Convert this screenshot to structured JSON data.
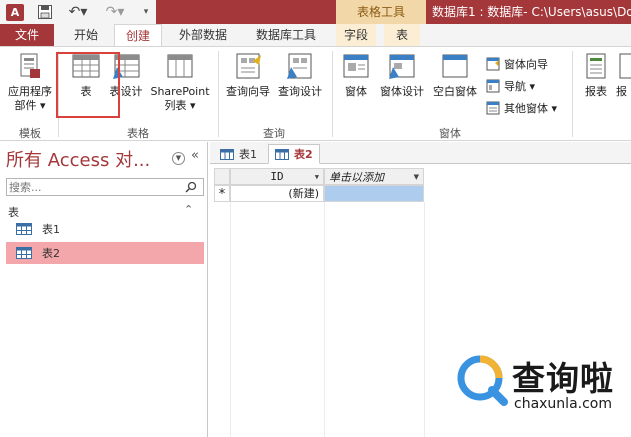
{
  "window": {
    "title": "数据库1 : 数据库- C:\\Users\\asus\\Do",
    "context_tab": "表格工具"
  },
  "quick_access": {
    "app_icon": "A",
    "icons": [
      "access-app-icon",
      "save-icon",
      "undo-icon",
      "redo-icon",
      "customize-quick-access-icon"
    ]
  },
  "ribbon_tabs": {
    "file": "文件",
    "home": "开始",
    "create": "创建",
    "external": "外部数据",
    "dbtools": "数据库工具",
    "fields": "字段",
    "table": "表"
  },
  "ribbon": {
    "templates": {
      "app_parts_line1": "应用程序",
      "app_parts_line2": "部件 ▾",
      "group": "模板"
    },
    "tables": {
      "table": "表",
      "table_design": "表设计",
      "sharepoint_line1": "SharePoint",
      "sharepoint_line2": "列表 ▾",
      "group": "表格"
    },
    "queries": {
      "wizard": "查询向导",
      "design": "查询设计",
      "group": "查询"
    },
    "forms": {
      "form": "窗体",
      "form_design": "窗体设计",
      "blank_form": "空白窗体",
      "form_wizard": "窗体向导",
      "navigation": "导航 ▾",
      "more_forms": "其他窗体 ▾",
      "group": "窗体"
    },
    "reports": {
      "report": "报表",
      "report_cut": "报"
    }
  },
  "nav_pane": {
    "title": "所有 Access 对...",
    "search_placeholder": "搜索...",
    "group_header": "表",
    "items": [
      {
        "label": "表1"
      },
      {
        "label": "表2"
      }
    ]
  },
  "doc_tabs": [
    {
      "label": "表1"
    },
    {
      "label": "表2"
    }
  ],
  "datasheet": {
    "columns": [
      "ID",
      "单击以添加"
    ],
    "new_record_marker": "*",
    "new_record_value": "(新建)"
  },
  "watermark": {
    "text": "查询啦",
    "url": "chaxunla.com"
  },
  "colors": {
    "access_brand": "#a4373a",
    "context_tab": "#f2d8a9",
    "selected_nav": "#f4a7aa",
    "selected_cell": "#aecdee",
    "highlight_box": "#d9413a"
  }
}
